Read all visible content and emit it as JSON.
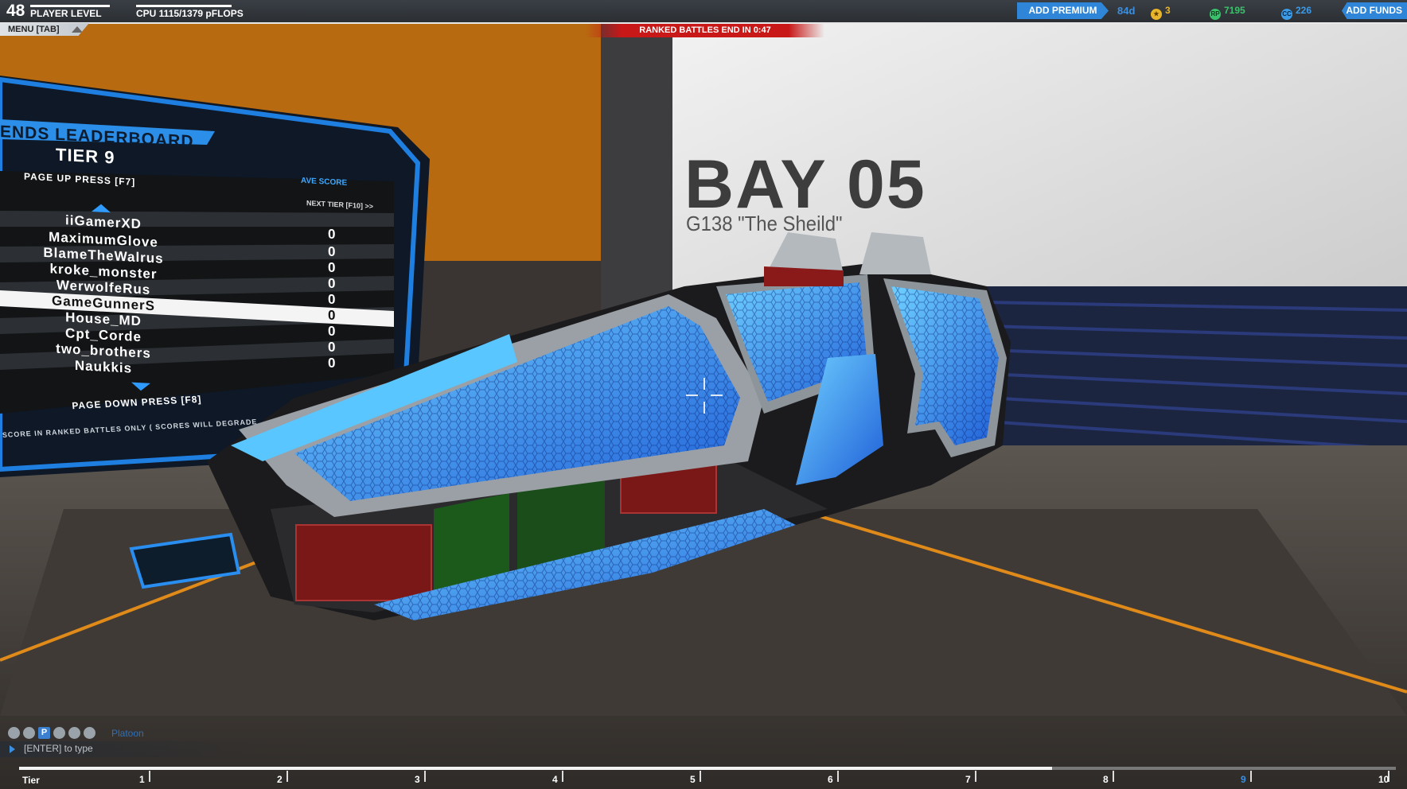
{
  "hud": {
    "player_level": "48",
    "player_level_label": "PLAYER LEVEL",
    "cpu_label": "CPU 1115/1379 pFLOPS",
    "menu_label": "MENU [TAB]",
    "ranked_banner": "RANKED BATTLES END IN 0:47",
    "add_premium_label": "ADD PREMIUM",
    "premium_days": "84d",
    "stars": "3",
    "robits": "7195",
    "cosmetic_credits": "226",
    "add_funds_label": "ADD FUNDS"
  },
  "bay": {
    "title": "BAY 05",
    "robot_name": "G138 \"The Sheild\""
  },
  "leaderboard": {
    "title": "ENDS LEADERBOARD",
    "tier": "TIER 9",
    "ave_score_label": "AVE SCORE",
    "page_up": "PAGE UP PRESS  [F7]",
    "next_tier": "NEXT TIER [F10]  >>",
    "page_down": "PAGE DOWN PRESS  [F8]",
    "footer": "SCORE IN RANKED BATTLES ONLY ( SCORES WILL DEGRADE",
    "rows": [
      {
        "name": "iiGamerXD",
        "score": "0"
      },
      {
        "name": "MaximumGlove",
        "score": "0"
      },
      {
        "name": "BlameTheWalrus",
        "score": "0"
      },
      {
        "name": "kroke_monster",
        "score": "0"
      },
      {
        "name": "WerwolfeRus",
        "score": "0"
      },
      {
        "name": "GameGunnerS",
        "score": "0",
        "selected": true
      },
      {
        "name": "House_MD",
        "score": "0"
      },
      {
        "name": "Cpt_Corde",
        "score": "0"
      },
      {
        "name": "two_brothers",
        "score": "0"
      },
      {
        "name": "Naukkis",
        "score": ""
      }
    ]
  },
  "chat": {
    "channel_label": "Platoon",
    "input_placeholder": "[ENTER] to type"
  },
  "tier_bar": {
    "label": "Tier",
    "ticks": [
      "1",
      "2",
      "3",
      "4",
      "5",
      "6",
      "7",
      "8",
      "9",
      "10"
    ],
    "current_tier": 9,
    "progress_fraction": 0.75
  }
}
